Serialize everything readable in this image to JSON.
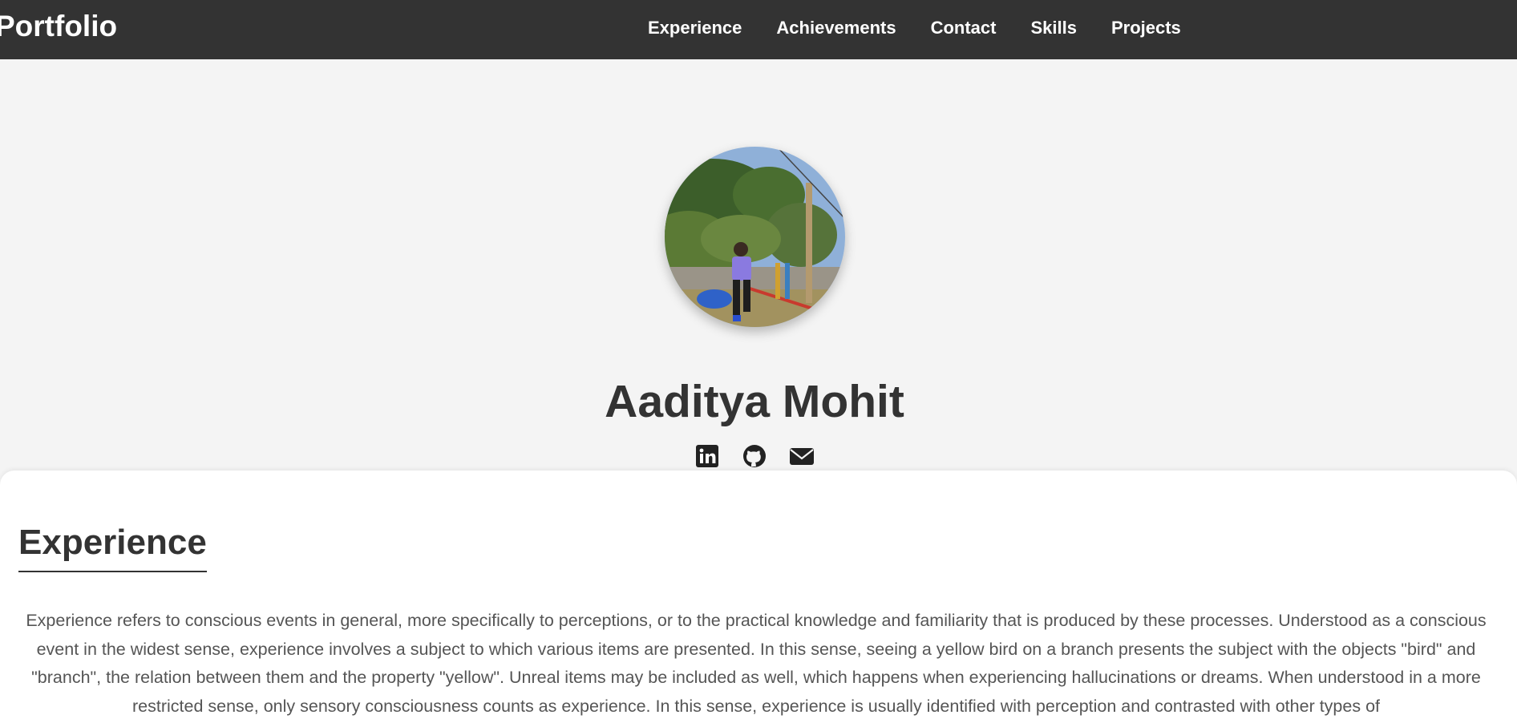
{
  "navbar": {
    "brand": "Portfolio",
    "links": [
      "Experience",
      "Achievements",
      "Contact",
      "Skills",
      "Projects"
    ]
  },
  "hero": {
    "name": "Aaditya Mohit",
    "avatar": "profile-photo",
    "socials": [
      "linkedin-icon",
      "github-icon",
      "envelope-icon"
    ]
  },
  "experience": {
    "title": "Experience",
    "text": "Experience refers to conscious events in general, more specifically to perceptions, or to the practical knowledge and familiarity that is produced by these processes. Understood as a conscious event in the widest sense, experience involves a subject to which various items are presented. In this sense, seeing a yellow bird on a branch presents the subject with the objects \"bird\" and \"branch\", the relation between them and the property \"yellow\". Unreal items may be included as well, which happens when experiencing hallucinations or dreams. When understood in a more restricted sense, only sensory consciousness counts as experience. In this sense, experience is usually identified with perception and contrasted with other types of"
  },
  "colors": {
    "navbar_bg": "#333333",
    "page_bg": "#f4f4f4",
    "section_bg": "#ffffff",
    "heading": "#333333",
    "body_text": "#555555"
  }
}
